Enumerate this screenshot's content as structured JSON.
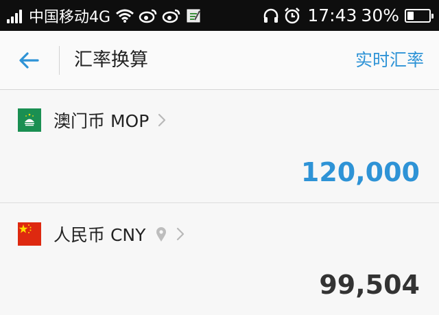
{
  "status_bar": {
    "carrier": "中国移动4G",
    "time": "17:43",
    "battery": "30%",
    "battery_fraction": 0.3,
    "icons": [
      "signal-icon",
      "wifi-icon",
      "weibo-icon",
      "weibo-icon",
      "notification-icon",
      "headphones-icon",
      "alarm-icon",
      "battery-icon"
    ]
  },
  "header": {
    "title": "汇率换算",
    "action_label": "实时汇率",
    "back_icon": "back-arrow-icon"
  },
  "colors": {
    "accent": "#2e93d6",
    "macau_flag_green": "#1a8f52",
    "china_flag_red": "#de2910",
    "china_flag_star": "#ffde00"
  },
  "currencies": [
    {
      "name": "澳门币 MOP",
      "flag_icon": "macau-flag-icon",
      "amount": "120,000"
    },
    {
      "name": "人民币 CNY",
      "flag_icon": "china-flag-icon",
      "amount": "99,504",
      "location_icon": "location-pin-icon"
    }
  ]
}
